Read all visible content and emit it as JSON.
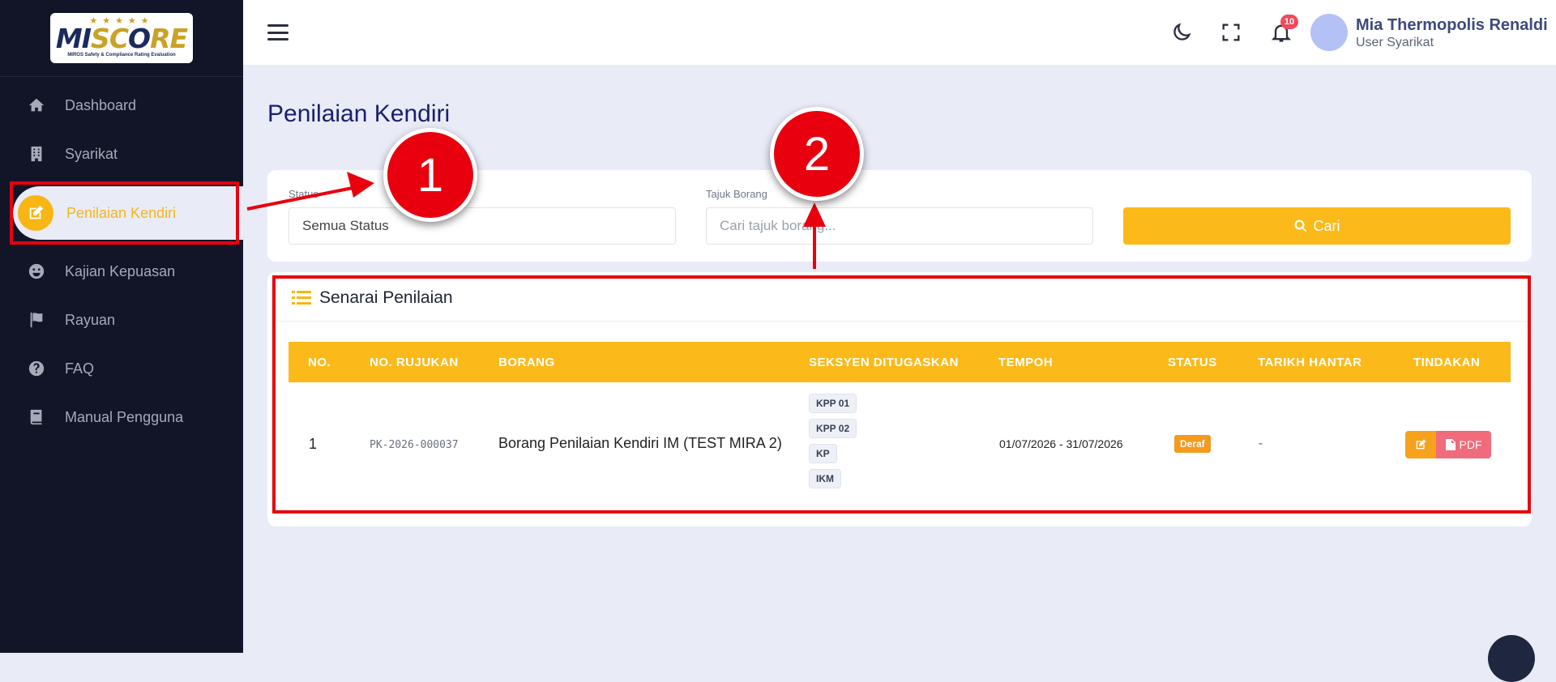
{
  "app": {
    "logo_text_a": "MI",
    "logo_text_b": "SC",
    "logo_text_c": "O",
    "logo_text_d": "RE",
    "logo_stars": "★★★★★",
    "logo_sub": "MIROS Safety & Compliance Rating Evaluation"
  },
  "sidebar": {
    "items": [
      {
        "label": "Dashboard",
        "icon": "home-icon"
      },
      {
        "label": "Syarikat",
        "icon": "building-icon"
      },
      {
        "label": "Penilaian Kendiri",
        "icon": "edit-icon"
      },
      {
        "label": "Kajian Kepuasan",
        "icon": "smile-icon"
      },
      {
        "label": "Rayuan",
        "icon": "flag-icon"
      },
      {
        "label": "FAQ",
        "icon": "question-icon"
      },
      {
        "label": "Manual Pengguna",
        "icon": "book-icon"
      }
    ]
  },
  "topbar": {
    "notif_count": "10",
    "user_name": "Mia Thermopolis Renaldi",
    "user_role": "User Syarikat"
  },
  "page": {
    "title": "Penilaian Kendiri"
  },
  "filter": {
    "status_label": "Status",
    "status_value": "Semua Status",
    "tajuk_label": "Tajuk Borang",
    "tajuk_placeholder": "Cari tajuk borang...",
    "search_button": "Cari"
  },
  "list": {
    "title": "Senarai Penilaian",
    "columns": [
      "NO.",
      "NO. RUJUKAN",
      "BORANG",
      "SEKSYEN DITUGASKAN",
      "TEMPOH",
      "STATUS",
      "TARIKH HANTAR",
      "TINDAKAN"
    ],
    "rows": [
      {
        "no": "1",
        "rujukan": "PK-2026-000037",
        "borang": "Borang Penilaian Kendiri IM (TEST MIRA 2)",
        "seksyen": [
          "KPP 01",
          "KPP 02",
          "KP",
          "IKM"
        ],
        "tempoh": "01/07/2026 - 31/07/2026",
        "status": "Deraf",
        "tarikh_hantar": "-",
        "pdf_label": "PDF"
      }
    ]
  },
  "annotations": {
    "one": "1",
    "two": "2"
  },
  "colors": {
    "accent": "#fbba1a",
    "sidebar": "#111527",
    "highlight": "#e8000e"
  }
}
